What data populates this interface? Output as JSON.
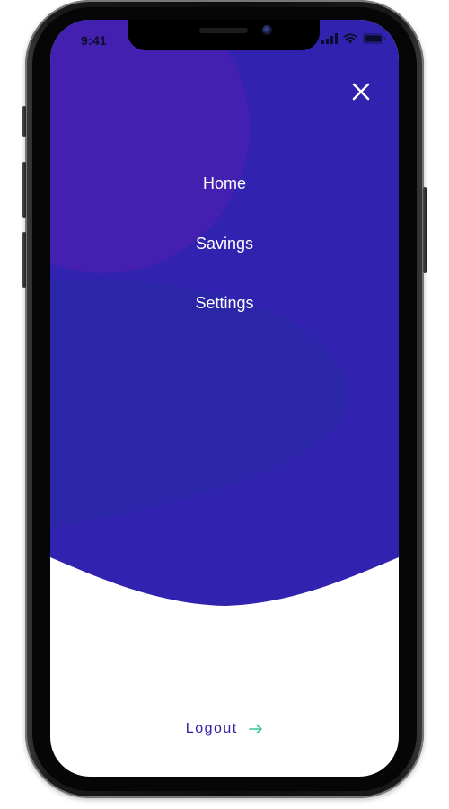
{
  "status_bar": {
    "time": "9:41",
    "signal_icon": "signal-bars-icon",
    "wifi_icon": "wifi-icon",
    "battery_icon": "battery-icon"
  },
  "close_icon": "close-icon",
  "menu": {
    "items": [
      {
        "label": "Home"
      },
      {
        "label": "Savings"
      },
      {
        "label": "Settings"
      }
    ]
  },
  "footer": {
    "logout_label": "Logout",
    "logout_icon": "arrow-right-icon"
  },
  "colors": {
    "primary": "#3123af",
    "primary_dark": "#2b21a6",
    "blob_purple": "#4420b0",
    "accent_green": "#35c98a",
    "text_on_primary": "#ffffff",
    "logout_text": "#2d1fa8"
  }
}
